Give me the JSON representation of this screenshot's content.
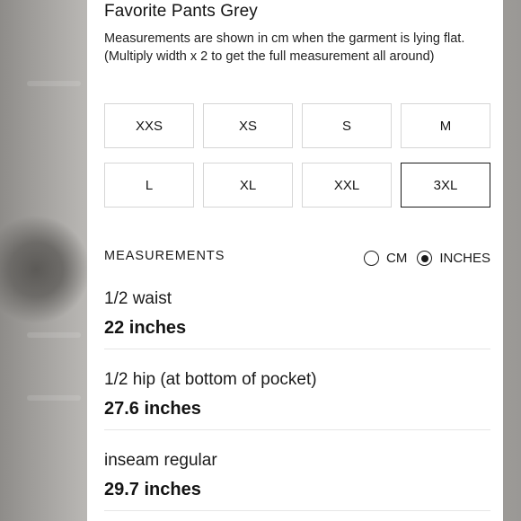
{
  "product": {
    "title": "Favorite Pants Grey",
    "description": "Measurements are shown in cm when the garment is lying flat. (Multiply width x 2 to get the full measurement all around)"
  },
  "sizes": [
    {
      "label": "XXS",
      "selected": false
    },
    {
      "label": "XS",
      "selected": false
    },
    {
      "label": "S",
      "selected": false
    },
    {
      "label": "M",
      "selected": false
    },
    {
      "label": "L",
      "selected": false
    },
    {
      "label": "XL",
      "selected": false
    },
    {
      "label": "XXL",
      "selected": false
    },
    {
      "label": "3XL",
      "selected": true
    }
  ],
  "measurements": {
    "heading": "MEASUREMENTS",
    "units": [
      {
        "label": "CM",
        "selected": false
      },
      {
        "label": "INCHES",
        "selected": true
      }
    ],
    "rows": [
      {
        "label": "1/2 waist",
        "value": "22 inches"
      },
      {
        "label": "1/2 hip (at bottom of pocket)",
        "value": "27.6 inches"
      },
      {
        "label": "inseam regular",
        "value": "29.7 inches"
      }
    ]
  }
}
